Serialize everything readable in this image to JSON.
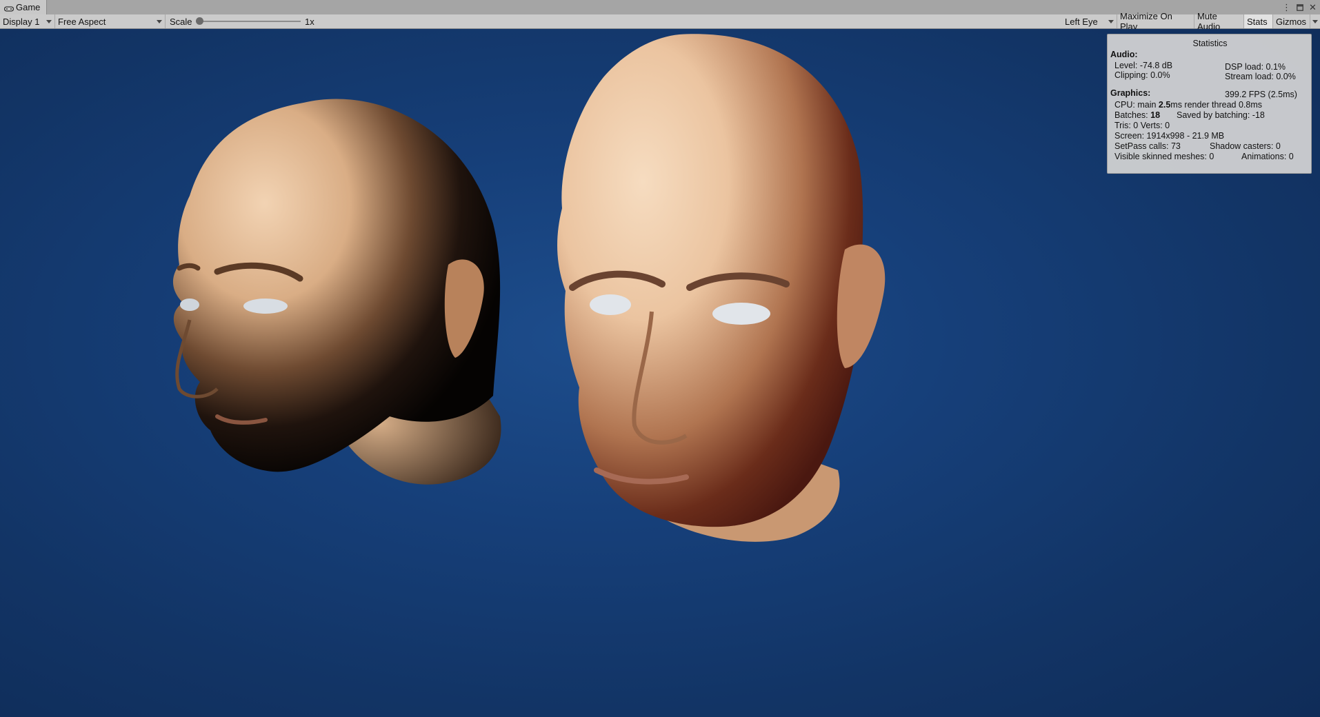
{
  "tab": {
    "title": "Game",
    "icon": "gamepad-icon"
  },
  "window_controls": [
    "kebab-menu-icon",
    "maximize-icon",
    "close-icon"
  ],
  "toolbar": {
    "display": "Display 1",
    "aspect": "Free Aspect",
    "scale_label": "Scale",
    "scale_value": "1x",
    "scale_level": 0.0,
    "eye": "Left Eye",
    "maximize_on_play": "Maximize On Play",
    "mute_audio": "Mute Audio",
    "stats": "Stats",
    "gizmos": "Gizmos",
    "stats_active": true
  },
  "colors": {
    "background": "#143a70",
    "toolbar": "#cbcbcb",
    "skin": "#e8b890"
  },
  "stats": {
    "title": "Statistics",
    "audio_header": "Audio:",
    "level": "Level: -74.8 dB",
    "clipping": "Clipping: 0.0%",
    "dsp_load": "DSP load: 0.1%",
    "stream_load": "Stream load: 0.0%",
    "graphics_header": "Graphics:",
    "fps": "399.2 FPS (2.5ms)",
    "cpu_prefix": "CPU: main ",
    "cpu_main": "2.5",
    "cpu_suffix": "ms  render thread 0.8ms",
    "batches_prefix": "Batches: ",
    "batches_value": "18",
    "saved_by_batching": "Saved by batching: -18",
    "tris_verts": "Tris: 0   Verts: 0",
    "screen": "Screen: 1914x998 - 21.9 MB",
    "setpass": "SetPass calls: 73",
    "shadow_casters": "Shadow casters: 0",
    "skinned_meshes": "Visible skinned meshes: 0",
    "animations": "Animations: 0"
  }
}
